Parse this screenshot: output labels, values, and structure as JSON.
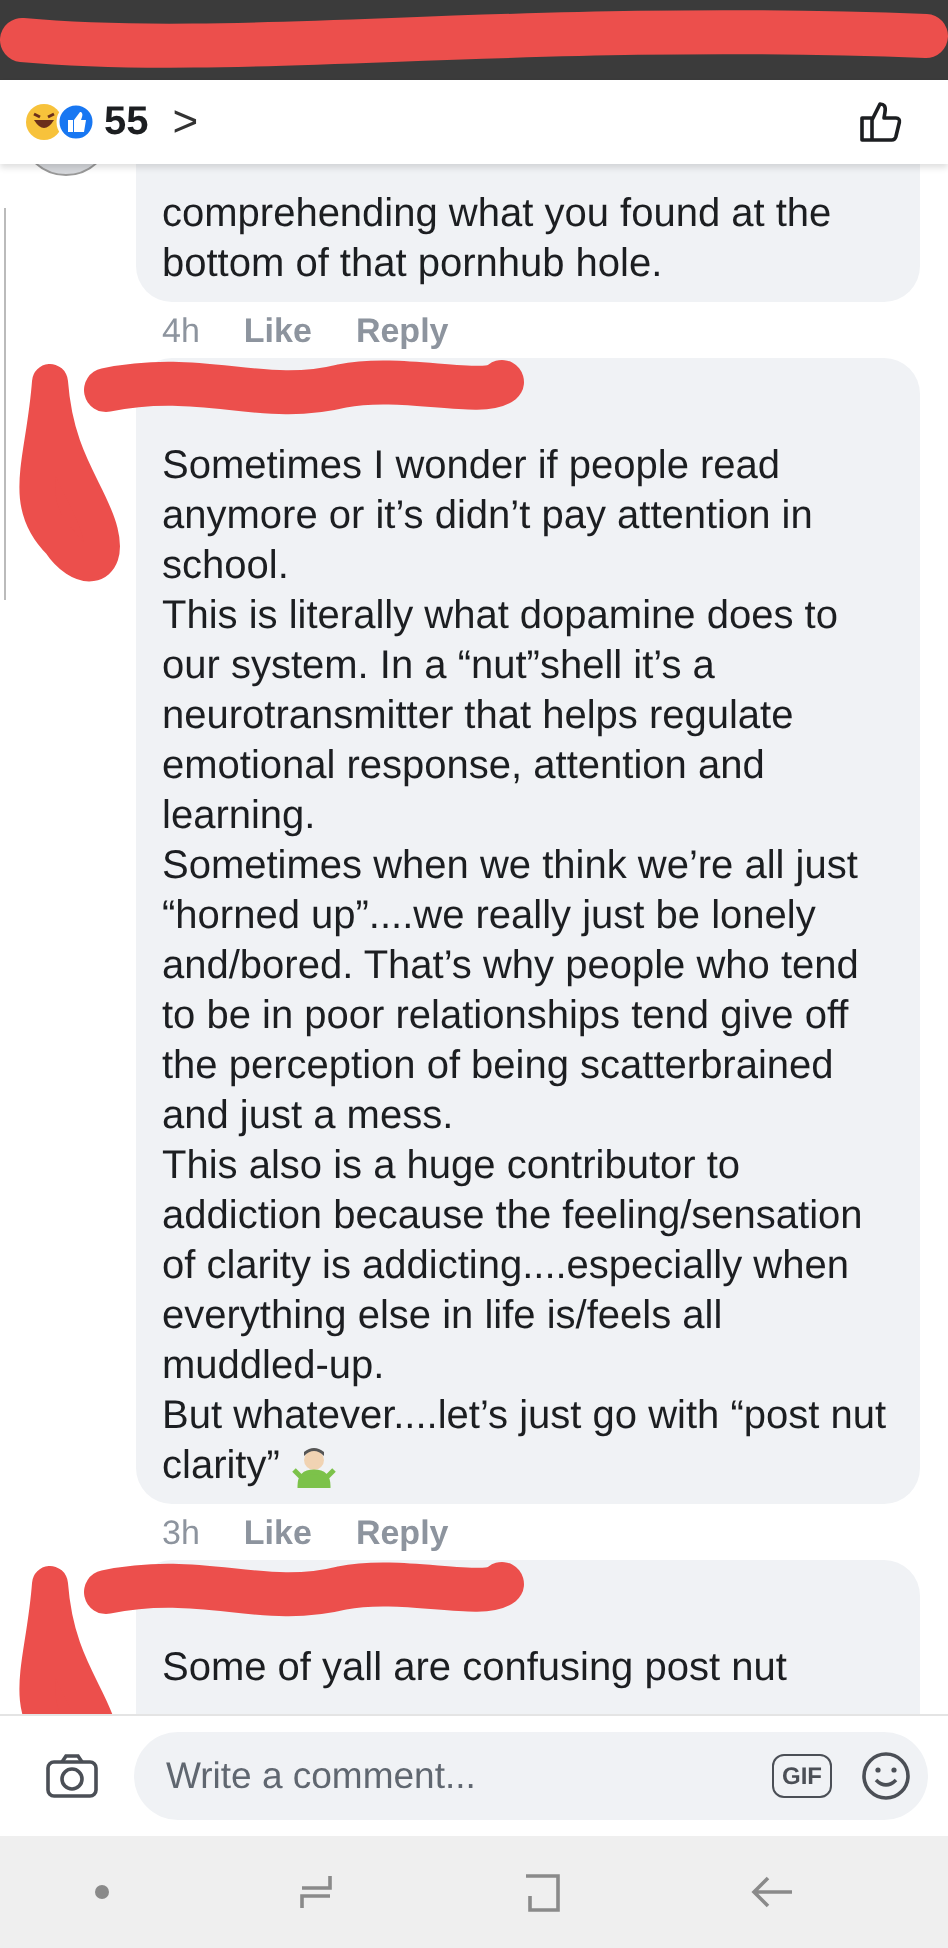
{
  "status_bar": {
    "redacted": true
  },
  "header": {
    "reaction_count": "55",
    "chevron": ">"
  },
  "comments": [
    {
      "author_redacted": false,
      "lines": [
        "comprehending what you found at the",
        "bottom of that pornhub hole."
      ],
      "time": "4h",
      "actions": [
        "Like",
        "Reply"
      ]
    },
    {
      "author_redacted": true,
      "lines": [
        "Sometimes I wonder if people read",
        "anymore or it’s didn’t pay attention in",
        "school.",
        "This is literally what dopamine does to",
        "our system. In a “nut”shell it’s a",
        "neurotransmitter that helps regulate",
        "emotional response, attention and",
        "learning.",
        "Sometimes when we think we’re all just",
        "“horned up”....we really just be lonely",
        "and/bored. That’s why people who tend",
        "to be in poor relationships tend give off",
        "the perception of being scatterbrained",
        "and just a mess.",
        "This also is a huge contributor to",
        "addiction because the feeling/sensation",
        "of clarity is addicting....especially when",
        "everything else in life is/feels all",
        "muddled-up.",
        "But whatever....let’s just go with “post nut",
        "clarity”"
      ],
      "emojis": [
        {
          "kind": "shrug"
        }
      ],
      "time": "3h",
      "actions": [
        "Like",
        "Reply"
      ]
    },
    {
      "author_redacted": true,
      "lines": [
        "Some of yall are confusing post nut"
      ]
    }
  ],
  "composer": {
    "placeholder": "Write a comment...",
    "gif_label": "GIF"
  }
}
